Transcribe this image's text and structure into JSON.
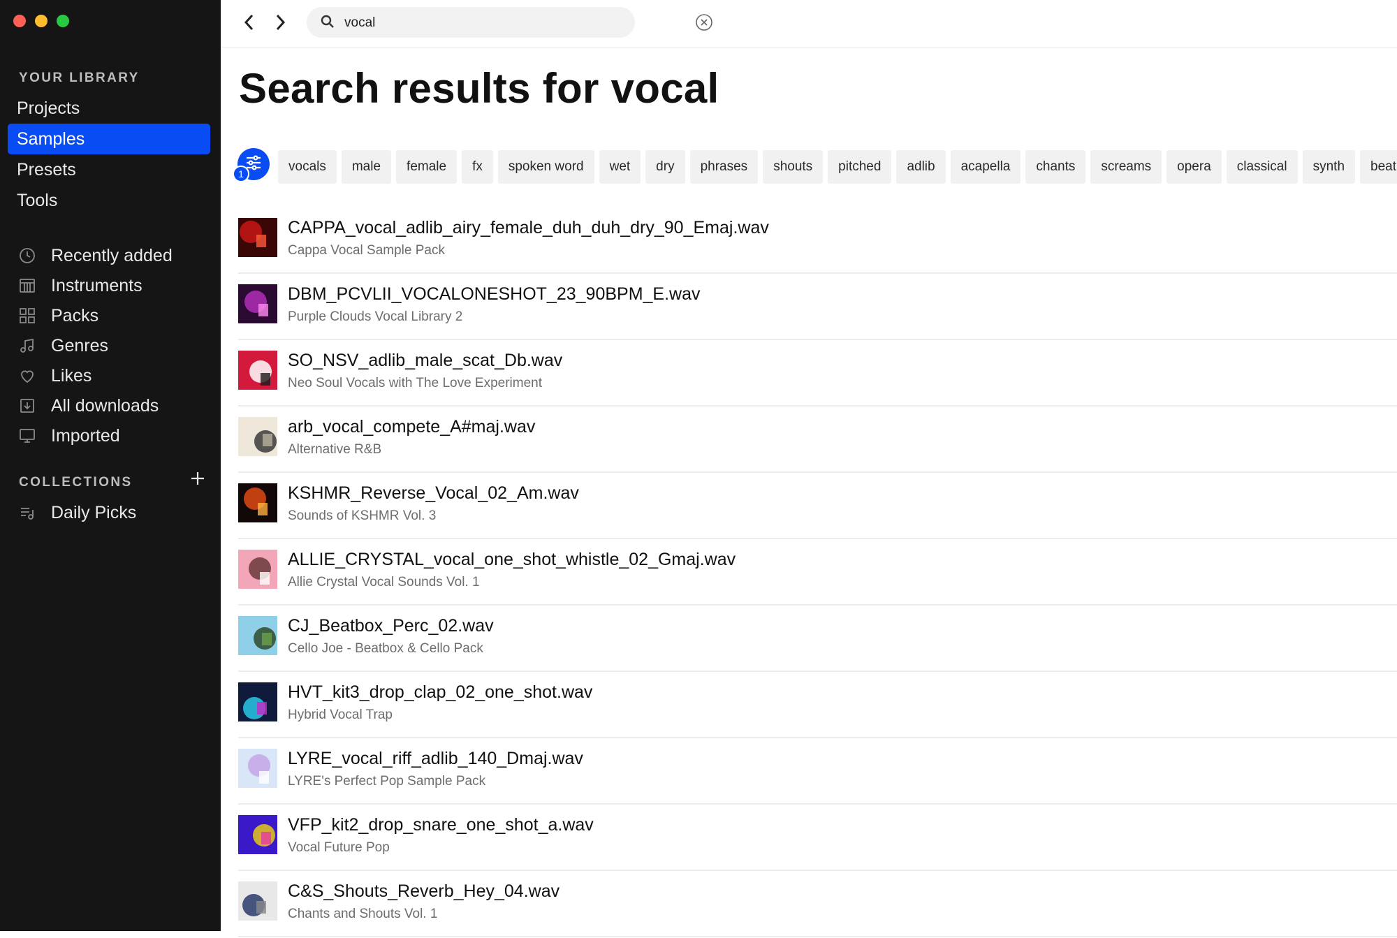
{
  "window": {
    "controls": [
      "close",
      "minimize",
      "zoom"
    ]
  },
  "sidebar": {
    "library_heading": "YOUR LIBRARY",
    "nav": [
      {
        "label": "Projects",
        "active": false
      },
      {
        "label": "Samples",
        "active": true
      },
      {
        "label": "Presets",
        "active": false
      },
      {
        "label": "Tools",
        "active": false
      }
    ],
    "library_items": [
      {
        "label": "Recently added",
        "icon": "clock-icon"
      },
      {
        "label": "Instruments",
        "icon": "instrument-icon"
      },
      {
        "label": "Packs",
        "icon": "grid-icon"
      },
      {
        "label": "Genres",
        "icon": "music-note-icon"
      },
      {
        "label": "Likes",
        "icon": "heart-icon"
      },
      {
        "label": "All downloads",
        "icon": "download-icon"
      },
      {
        "label": "Imported",
        "icon": "monitor-icon"
      }
    ],
    "collections_heading": "COLLECTIONS",
    "collections": [
      {
        "label": "Daily Picks",
        "icon": "playlist-icon"
      }
    ]
  },
  "search": {
    "value": "vocal",
    "placeholder": ""
  },
  "page_title": "Search results for vocal",
  "filters": {
    "active_count": "1",
    "tags": [
      "vocals",
      "male",
      "female",
      "fx",
      "spoken word",
      "wet",
      "dry",
      "phrases",
      "shouts",
      "pitched",
      "adlib",
      "acapella",
      "chants",
      "screams",
      "opera",
      "classical",
      "synth",
      "beatb"
    ]
  },
  "results": [
    {
      "name": "CAPPA_vocal_adlib_airy_female_duh_duh_dry_90_Emaj.wav",
      "pack": "Cappa Vocal Sample Pack",
      "art_colors": [
        "#3a0606",
        "#c81818",
        "#ff5a3a"
      ]
    },
    {
      "name": "DBM_PCVLII_VOCALONESHOT_23_90BPM_E.wav",
      "pack": "Purple Clouds Vocal Library 2",
      "art_colors": [
        "#2a0a30",
        "#b02eb8",
        "#ff8af0"
      ]
    },
    {
      "name": "SO_NSV_adlib_male_scat_Db.wav",
      "pack": "Neo Soul Vocals with The Love Experiment",
      "art_colors": [
        "#d41a3c",
        "#ffffff",
        "#1a1a1a"
      ]
    },
    {
      "name": "arb_vocal_compete_A#maj.wav",
      "pack": "Alternative R&B",
      "art_colors": [
        "#efe8da",
        "#3a3a3a",
        "#b8b0a0"
      ]
    },
    {
      "name": "KSHMR_Reverse_Vocal_02_Am.wav",
      "pack": "Sounds of KSHMR Vol. 3",
      "art_colors": [
        "#120808",
        "#e04a14",
        "#ffb040"
      ]
    },
    {
      "name": "ALLIE_CRYSTAL_vocal_one_shot_whistle_02_Gmaj.wav",
      "pack": "Allie Crystal Vocal Sounds Vol. 1",
      "art_colors": [
        "#f3a6b8",
        "#6a3a3a",
        "#ffffff"
      ]
    },
    {
      "name": "CJ_Beatbox_Perc_02.wav",
      "pack": "Cello Joe - Beatbox & Cello Pack",
      "art_colors": [
        "#8fd0e8",
        "#2f4a2a",
        "#6aa048"
      ]
    },
    {
      "name": "HVT_kit3_drop_clap_02_one_shot.wav",
      "pack": "Hybrid Vocal Trap",
      "art_colors": [
        "#101a3a",
        "#28c8e8",
        "#c828c8"
      ]
    },
    {
      "name": "LYRE_vocal_riff_adlib_140_Dmaj.wav",
      "pack": "LYRE's Perfect Pop Sample Pack",
      "art_colors": [
        "#d8e6f8",
        "#c6a4e8",
        "#ffffff"
      ]
    },
    {
      "name": "VFP_kit2_drop_snare_one_shot_a.wav",
      "pack": "Vocal Future Pop",
      "art_colors": [
        "#3a1ac8",
        "#e8c818",
        "#e838a8"
      ]
    },
    {
      "name": "C&S_Shouts_Reverb_Hey_04.wav",
      "pack": "Chants and Shouts Vol. 1",
      "art_colors": [
        "#e8e8e8",
        "#2a3a6a",
        "#8a8a8a"
      ]
    }
  ],
  "colors": {
    "accent": "#0a4cf4",
    "sidebar_bg": "#151515"
  }
}
